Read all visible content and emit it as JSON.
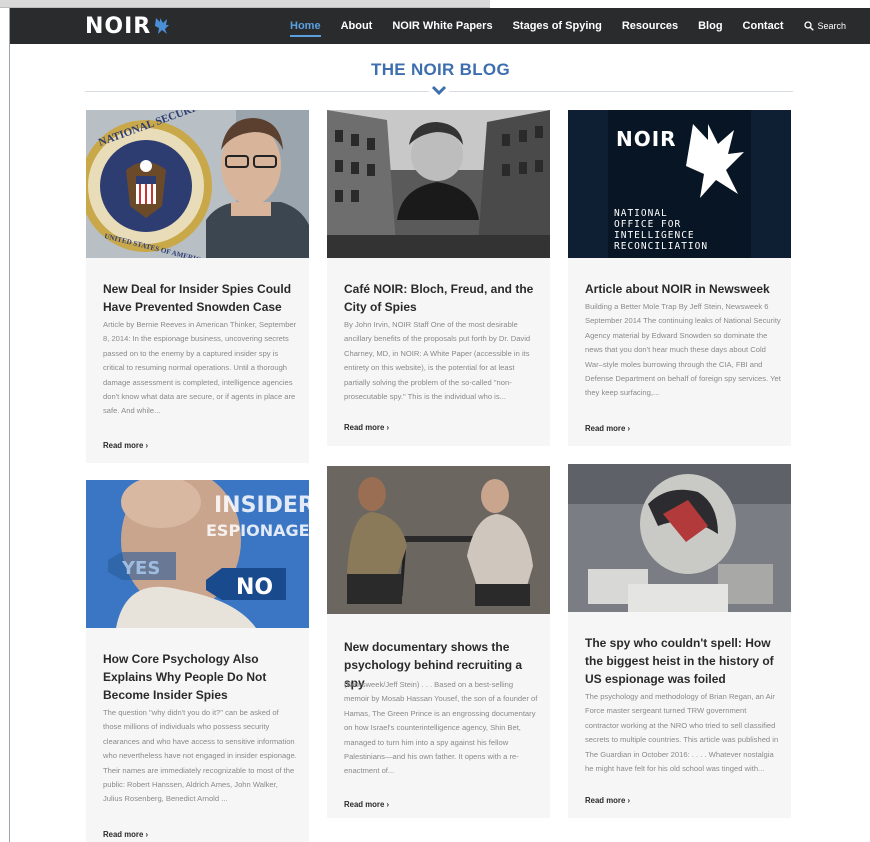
{
  "brand": {
    "logo_text": "NOIR",
    "accent": "#5aa0e0",
    "nav_bg": "#2a2b2d",
    "title_color": "#3d6fae"
  },
  "nav": {
    "items": [
      {
        "label": "Home",
        "active": true
      },
      {
        "label": "About"
      },
      {
        "label": "NOIR White Papers"
      },
      {
        "label": "Stages of Spying"
      },
      {
        "label": "Resources"
      },
      {
        "label": "Blog"
      },
      {
        "label": "Contact"
      }
    ],
    "search_label": "Search",
    "search_icon": "search-icon"
  },
  "page": {
    "title": "THE NOIR BLOG",
    "divider_icon": "chevron-down-icon"
  },
  "posts": [
    {
      "title": "New Deal for Insider Spies Could Have Prevented Snowden Case",
      "excerpt": "Article by Bernie Reeves in American Thinker, September 8, 2014: In the espionage business, uncovering secrets passed on to the enemy by a captured insider spy is critical to resuming normal operations. Until a thorough damage assessment is completed, intelligence agencies don't know what data are secure, or if agents in place are safe. And while...",
      "read_more": "Read more",
      "image": "NSA seal and man with glasses",
      "image_text": [
        "NATIONAL SECURITY",
        "UNITED STATES OF AMERICA"
      ]
    },
    {
      "title": "Café NOIR: Bloch, Freud, and the City of Spies",
      "excerpt": "By John Irvin, NOIR Staff One of the most desirable ancillary benefits of the proposals put forth by Dr. David Charney, MD, in NOIR: A White Paper (accessible in its entirety on this website), is the potential for at least partially solving the problem of the so-called \"non-prosecutable spy.\" This is the individual who is...",
      "read_more": "Read more",
      "image": "black and white city street with man"
    },
    {
      "title": "Article about NOIR in Newsweek",
      "excerpt": "Building a Better Mole Trap By Jeff Stein, Newsweek 6 September 2014 The continuing leaks of National Security Agency material by Edward Snowden so dominate the news that you don't hear much these days about Cold War–style moles burrowing through the CIA, FBI and Defense Department on behalf of foreign spy services. Yet they keep surfacing,...",
      "read_more": "Read more",
      "image": "NOIR eagle logo",
      "image_text": [
        "NOIR",
        "NATIONAL",
        "OFFICE FOR",
        "INTELLIGENCE",
        "RECONCILIATION"
      ]
    },
    {
      "title": "How Core Psychology Also Explains Why People Do Not Become Insider Spies",
      "excerpt": "The question \"why didn't you do it?\" can be asked of those millions of individuals who possess security clearances and who have access to sensitive information who nevertheless have not engaged in insider espionage. Their names are immediately recognizable to most of the public: Robert Hanssen, Aldrich Ames, John Walker, Julius Rosenberg, Benedict Arnold ...",
      "read_more": "Read more",
      "image": "insider espionage yes no",
      "image_text": [
        "INSIDER",
        "ESPIONAGE",
        "YES",
        "NO"
      ]
    },
    {
      "title": "New documentary shows the psychology behind recruiting a spy",
      "excerpt": "(Newsweek/Jeff Stein) . . . Based on a best-selling memoir by Mosab Hassan Yousef, the son of a founder of Hamas, The Green Prince is an engrossing documentary on how Israel's counterintelligence agency, Shin Bet, managed to turn him into a spy against his fellow Palestinians—and his own father. It opens with a re-enactment of...",
      "read_more": "Read more",
      "image": "two men at a table"
    },
    {
      "title": "The spy who couldn't spell: How the biggest heist in the history of US espionage was foiled",
      "excerpt": "The psychology and methodology of Brian Regan, an Air Force master sergeant turned TRW government contractor working at the NRO who tried to sell classified secrets to multiple countries. This article was published in The Guardian in October 2016: . . . . Whatever nostalgia he might have felt for his old school was tinged with...",
      "read_more": "Read more",
      "image": "grainy surveillance still"
    }
  ]
}
